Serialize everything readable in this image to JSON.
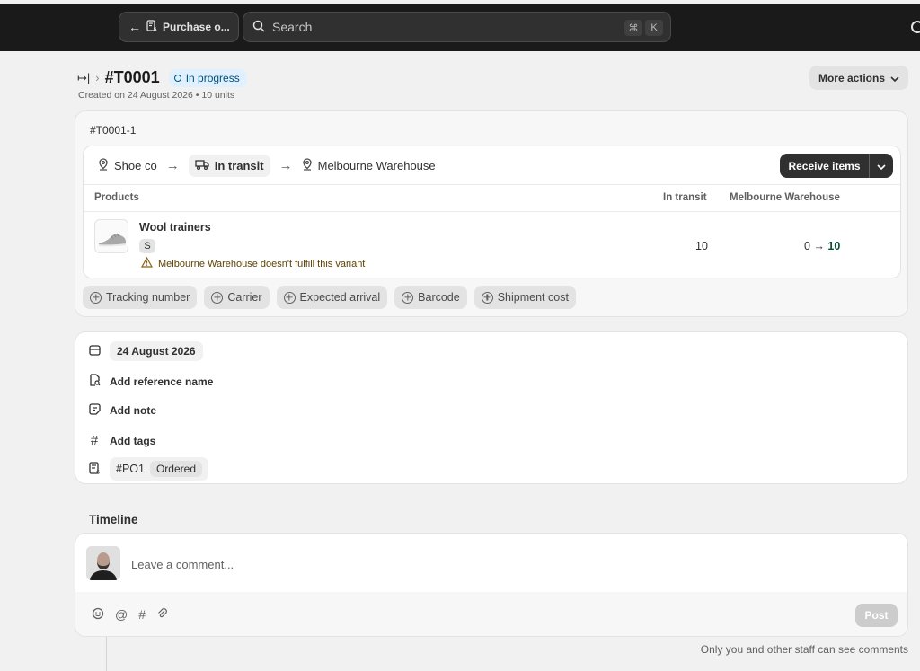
{
  "topbar": {
    "back_label": "Purchase o...",
    "search_placeholder": "Search",
    "shortcut_keys": [
      "⌘",
      "K"
    ]
  },
  "header": {
    "title": "#T0001",
    "status": "In progress",
    "subtitle": "Created on 24 August 2026 • 10 units",
    "more_actions": "More actions"
  },
  "shipment": {
    "id": "#T0001-1",
    "origin": "Shoe co",
    "status": "In transit",
    "destination": "Melbourne Warehouse",
    "receive_label": "Receive items",
    "columns": [
      "Products",
      "In transit",
      "Melbourne Warehouse"
    ],
    "product": {
      "name": "Wool trainers",
      "variant": "S",
      "warning": "Melbourne Warehouse doesn't fulfill this variant",
      "in_transit": "10",
      "warehouse_from": "0",
      "warehouse_to": "10"
    },
    "chips": [
      "Tracking number",
      "Carrier",
      "Expected arrival",
      "Barcode",
      "Shipment cost"
    ]
  },
  "details": {
    "date": "24 August 2026",
    "reference": "Add reference name",
    "note": "Add note",
    "tags": "Add tags",
    "po_number": "#PO1",
    "po_status": "Ordered"
  },
  "timeline": {
    "title": "Timeline",
    "comment_placeholder": "Leave a comment...",
    "post_label": "Post",
    "note": "Only you and other staff can see comments"
  }
}
